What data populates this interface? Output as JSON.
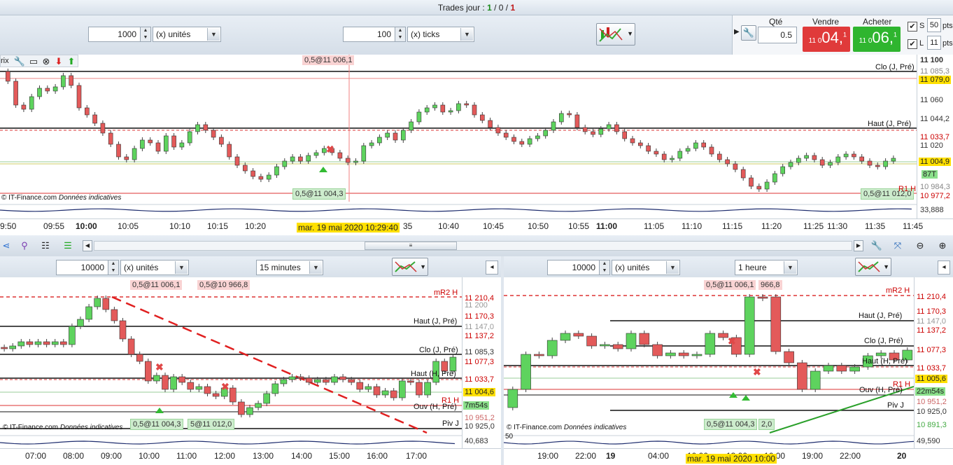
{
  "titlebar": {
    "prefix": "Trades jour : ",
    "wins": "1",
    "sep1": " / ",
    "neutral": "0",
    "sep2": " / ",
    "losses": "1"
  },
  "toolbar": {
    "qty_value": "1000",
    "qty_unit": "(x) unités",
    "ticks_value": "100",
    "ticks_unit": "(x) ticks"
  },
  "order": {
    "qty_label": "Qté",
    "qty_value": "0.5",
    "sell_label": "Vendre",
    "buy_label": "Acheter",
    "sell_prefix": "11 0",
    "sell_big": "04,",
    "sell_sup": "1",
    "buy_prefix": "11 0",
    "buy_big": "06,",
    "buy_sup": "1",
    "stop_label": "S",
    "stop_value": "50",
    "limit_label": "L",
    "limit_value": "11",
    "pts": "pts",
    "colors": {
      "sell": "#e03a3a",
      "buy": "#2fb52f"
    }
  },
  "top_chart": {
    "corner_label": "rix",
    "tag_sell": "0,5@11 006,1",
    "tag_buy": "0,5@11 004,3",
    "tag_buy2": "0,5@11 012,0",
    "watermark": "© IT-Finance.com",
    "watermark_note": "Données indicatives",
    "levels": {
      "clo": "Clo (J, Pré)",
      "haut": "Haut (J, Pré)",
      "r1": "R1 H"
    },
    "axis": [
      "11 100",
      "11 085,3",
      "11 079,0",
      "11 060",
      "11 044,2",
      "11 033,7",
      "11 020",
      "11 004,9",
      "87T",
      "10 984,3",
      "10 977,2",
      "33,888"
    ],
    "times": [
      "9:50",
      "09:55",
      "10:00",
      "10:05",
      "10:10",
      "10:15",
      "10:20",
      "35",
      "10:40",
      "10:45",
      "10:50",
      "10:55",
      "11:00",
      "11:05",
      "11:10",
      "11:15",
      "11:20",
      "11:25",
      "11:30",
      "11:35",
      "11:45"
    ],
    "cursor_time": "mar. 19 mai 2020 10:29:40"
  },
  "left_chart": {
    "qty_value": "10000",
    "unit": "(x) unités",
    "period": "15 minutes",
    "tag_a": "0,5@11 006,1",
    "tag_b": "0,5@10 966,8",
    "tag_c": "0,5@11 004,3",
    "tag_d": "5@11 012,0",
    "levels": {
      "mr2": "mR2 H",
      "haut": "Haut (J, Pré)",
      "clo": "Clo (J, Pré)",
      "hautH": "Haut (H, Pré)",
      "r1": "R1 H",
      "ouv": "Ouv (H, Pré)",
      "piv": "Piv J"
    },
    "watermark": "© IT-Finance.com",
    "watermark_note": "Données indicatives",
    "axis": [
      "11 210,4",
      "11 200",
      "11 170,3",
      "11 147,0",
      "11 137,2",
      "11 085,3",
      "11 077,3",
      "11 033,7",
      "11 004,6",
      "7m54s",
      "10 951,2",
      "10 925,0",
      "40,683"
    ],
    "times": [
      "07:00",
      "08:00",
      "09:00",
      "10:00",
      "11:00",
      "12:00",
      "13:00",
      "14:00",
      "15:00",
      "16:00",
      "17:00"
    ]
  },
  "right_chart": {
    "qty_value": "10000",
    "unit": "(x) unités",
    "period": "1 heure",
    "tag_a": "0,5@11 006,1",
    "tag_b": "966,8",
    "tag_c": "0,5@11 004,3",
    "tag_d": "2,0",
    "levels": {
      "mr2": "mR2 H",
      "haut": "Haut (J, Pré)",
      "clo": "Clo (J, Pré)",
      "hautH": "Haut (H, Pré)",
      "r1": "R1 H",
      "ouv": "Ouv (H, Pré)",
      "piv": "Piv J"
    },
    "watermark": "© IT-Finance.com",
    "watermark_note": "Données indicatives",
    "axis": [
      "11 210,4",
      "11 170,3",
      "11 147,0",
      "11 137,2",
      "11 077,3",
      "11 033,7",
      "11 005,6",
      "22m54s",
      "10 951,2",
      "10 925,0",
      "10 891,3",
      "49,590"
    ],
    "axis_low": "50",
    "times": [
      "19:00",
      "22:00",
      "19",
      "04:00",
      "10:00",
      "13:00",
      "16:00",
      "19:00",
      "22:00",
      "20"
    ],
    "cursor_time": "mar. 19 mai 2020 10:00"
  }
}
